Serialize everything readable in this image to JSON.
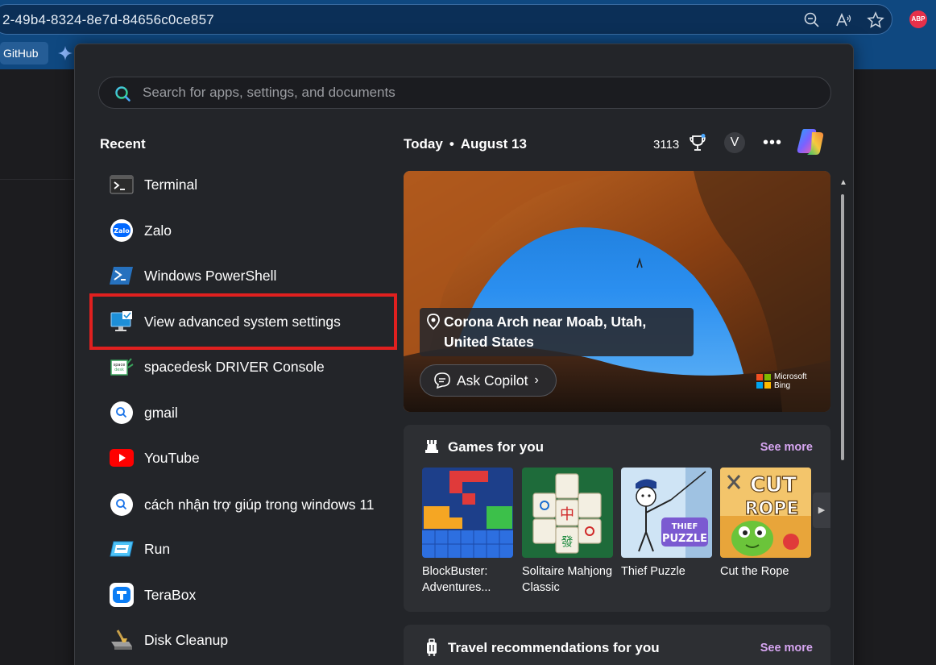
{
  "browser": {
    "url": "2-49b4-8324-8e7d-84656c0ce857",
    "bookmark_github": "GitHub",
    "extension_badge": "ABP"
  },
  "start_menu": {
    "search": {
      "placeholder": "Search for apps, settings, and documents"
    },
    "recent": {
      "heading": "Recent",
      "items": [
        {
          "label": "Terminal",
          "icon": "terminal-icon"
        },
        {
          "label": "Zalo",
          "icon": "zalo-icon"
        },
        {
          "label": "Windows PowerShell",
          "icon": "powershell-icon"
        },
        {
          "label": "View advanced system settings",
          "icon": "system-settings-icon",
          "highlighted": true
        },
        {
          "label": "spacedesk DRIVER Console",
          "icon": "spacedesk-icon"
        },
        {
          "label": "gmail",
          "icon": "web-search-icon"
        },
        {
          "label": "YouTube",
          "icon": "youtube-icon"
        },
        {
          "label": "cách nhận trợ giúp trong windows 11",
          "icon": "web-search-icon"
        },
        {
          "label": "Run",
          "icon": "run-icon"
        },
        {
          "label": "TeraBox",
          "icon": "terabox-icon"
        },
        {
          "label": "Disk Cleanup",
          "icon": "disk-cleanup-icon"
        }
      ]
    },
    "today": {
      "label": "Today",
      "date": "August 13",
      "points": "3113",
      "avatar_initial": "V"
    },
    "hero": {
      "location": "Corona Arch near Moab, Utah, United States",
      "ask_copilot": "Ask Copilot",
      "bing_logo": "Microsoft Bing"
    },
    "games": {
      "title": "Games for you",
      "see_more": "See more",
      "items": [
        {
          "name": "BlockBuster: Adventures..."
        },
        {
          "name": "Solitaire Mahjong Classic"
        },
        {
          "name": "Thief Puzzle"
        },
        {
          "name": "Cut the Rope"
        }
      ]
    },
    "travel": {
      "title": "Travel recommendations for you",
      "see_more": "See more"
    }
  },
  "colors": {
    "panel_bg": "#232529",
    "card_bg": "#2d2f33",
    "accent_link": "#d7a6f2",
    "highlight_red": "#e0201f",
    "browser_blue": "#0f4880"
  }
}
